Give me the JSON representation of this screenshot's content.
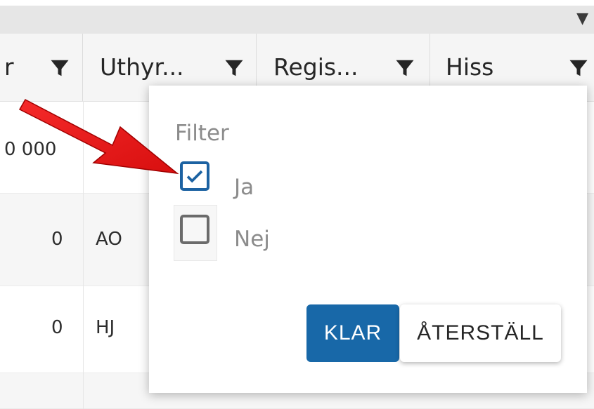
{
  "header": {
    "columns": [
      {
        "label": "r"
      },
      {
        "label": "Uthyr..."
      },
      {
        "label": "Regis..."
      },
      {
        "label": "Hiss"
      }
    ]
  },
  "rows": [
    {
      "num": "0 000",
      "code": ""
    },
    {
      "num": "0",
      "code": "AO"
    },
    {
      "num": "0",
      "code": "HJ"
    }
  ],
  "filter_popup": {
    "title": "Filter",
    "options": [
      {
        "label": "Ja",
        "checked": true
      },
      {
        "label": "Nej",
        "checked": false
      }
    ],
    "apply_label": "KLAR",
    "reset_label": "ÅTERSTÄLL"
  },
  "colors": {
    "accent": "#1868a8",
    "annotation_arrow": "#ee1c1c"
  },
  "icons": [
    "filter-icon",
    "dropdown-caret-icon",
    "checkmark-icon"
  ]
}
